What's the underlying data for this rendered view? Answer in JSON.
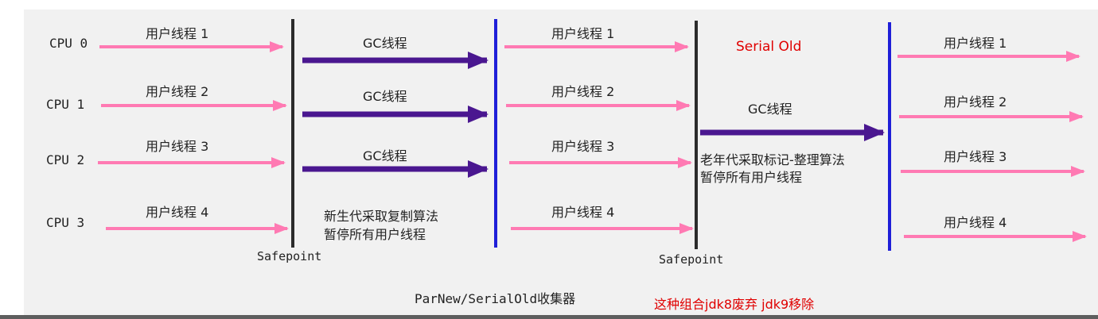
{
  "colors": {
    "user_thread_arrow": "#ff7ab3",
    "gc_arrow": "#4a1790",
    "safepoint_line": "#2b2b2b",
    "resume_line": "#1f1fd8",
    "accent_red": "#e00000",
    "background": "#f1f1f1"
  },
  "cpus": [
    "CPU 0",
    "CPU 1",
    "CPU 2",
    "CPU 3"
  ],
  "phase1_threads": [
    "用户线程 1",
    "用户线程 2",
    "用户线程 3",
    "用户线程 4"
  ],
  "young_gc": {
    "thread_labels": [
      "GC线程",
      "GC线程",
      "GC线程"
    ],
    "caption_lines": [
      "新生代采取复制算法",
      "暂停所有用户线程"
    ]
  },
  "phase2_threads": [
    "用户线程 1",
    "用户线程 2",
    "用户线程 3",
    "用户线程 4"
  ],
  "old_gc": {
    "collector_name": "Serial Old",
    "thread_label": "GC线程",
    "caption_lines": [
      "老年代采取标记-整理算法",
      "暂停所有用户线程"
    ]
  },
  "phase3_threads": [
    "用户线程 1",
    "用户线程 2",
    "用户线程 3",
    "用户线程 4"
  ],
  "safepoint_labels": [
    "Safepoint",
    "Safepoint"
  ],
  "footer": {
    "title": "ParNew/SerialOld收集器",
    "note": "这种组合jdk8废弃 jdk9移除"
  }
}
